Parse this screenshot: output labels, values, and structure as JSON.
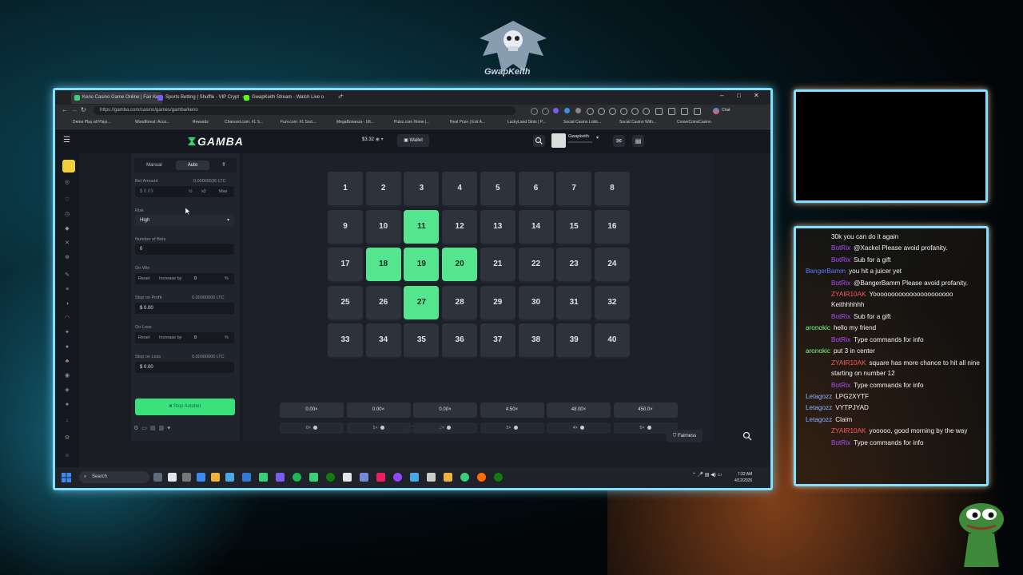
{
  "stream_overlay": {
    "logo_text": "GwapKeith"
  },
  "browser": {
    "tabs": [
      {
        "title": "Keno Casino Game Online | Fair Ke",
        "favicon_color": "#3ad07a",
        "active": true
      },
      {
        "title": "Sports Betting | Shuffle - VIP Crypt",
        "favicon_color": "#7b5cf0",
        "active": false
      },
      {
        "title": "GwapKeith Stream - Watch Live o",
        "favicon_color": "#53fc18",
        "active": false
      }
    ],
    "new_tab": "+",
    "url": "https://gamba.com/casino/games/gamba/keno",
    "bookmarks": [
      "Demo Play all Playi...",
      "Woodforest: Acco...",
      "Rewards",
      "Chanced.com: #1 S...",
      "Funr.com: #1 Soci...",
      "MegaBonanza - Ult...",
      "Pulsz.com Home |...",
      "Real Prize | Exit A...",
      "LuckyLand Slots | P...",
      "Social Casino Lobb...",
      "Social Casino With...",
      "CrownCoinsCasino"
    ],
    "profile_label": "Chat"
  },
  "site": {
    "brand": "GAMBA",
    "balance": "$3.32",
    "wallet_label": "Wallet",
    "username": "Gwapkeith"
  },
  "panel": {
    "tabs": [
      "Manual",
      "Auto"
    ],
    "active_tab": "Auto",
    "bet_amount_label": "Bet Amount",
    "bet_amount_ltc": "0.00065536 LTC",
    "bet_amount_value": "0.03",
    "half_label": "½",
    "double_label": "x2",
    "max_label": "Max",
    "risk_label": "Risk",
    "risk_value": "High",
    "num_bets_label": "Number of Bets",
    "num_bets_value": "0",
    "on_win_label": "On Win",
    "on_win_reset": "Reset",
    "on_win_increase": "Increase by",
    "on_win_value": "0",
    "on_win_unit": "%",
    "stop_profit_label": "Stop on Profit",
    "stop_profit_ltc": "0.00000000 LTC",
    "stop_profit_value": "0.00",
    "on_loss_label": "On Loss",
    "on_loss_reset": "Reset",
    "on_loss_increase": "Increase by",
    "on_loss_value": "0",
    "on_loss_unit": "%",
    "stop_loss_label": "Stop on Loss",
    "stop_loss_ltc": "0.00000000 LTC",
    "stop_loss_value": "0.00",
    "cta_label": "Stop Autobet"
  },
  "keno": {
    "numbers": [
      1,
      2,
      3,
      4,
      5,
      6,
      7,
      8,
      9,
      10,
      11,
      12,
      13,
      14,
      15,
      16,
      17,
      18,
      19,
      20,
      21,
      22,
      23,
      24,
      25,
      26,
      27,
      28,
      29,
      30,
      31,
      32,
      33,
      34,
      35,
      36,
      37,
      38,
      39,
      40
    ],
    "highlighted": [
      11,
      18,
      19,
      20,
      27
    ],
    "highlight_color": "#55e58f",
    "multipliers": [
      "0.00×",
      "0.00×",
      "0.00×",
      "4.50×",
      "48.00×",
      "450.0×"
    ],
    "hit_labels": [
      "0×",
      "1×",
      "2×",
      "3×",
      "4×",
      "5×"
    ]
  },
  "footer": {
    "fairness_label": "Fairness",
    "watermark": "GAMBA"
  },
  "taskbar": {
    "search_label": "Search",
    "time": "7:32 AM",
    "date": "4/12/2026"
  },
  "chat": {
    "messages": [
      {
        "user": "",
        "user_color": "#ffffff",
        "text": "30k you can do it again"
      },
      {
        "user": "BotRix",
        "user_color": "#b04cff",
        "text": "@Xackel Please avoid profanity."
      },
      {
        "user": "BotRix",
        "user_color": "#b04cff",
        "text": "Sub for a gift"
      },
      {
        "user": "BangerBamm",
        "user_color": "#5c7cff",
        "text": "you hit a juicer yet"
      },
      {
        "user": "BotRix",
        "user_color": "#b04cff",
        "text": "@BangerBamm Please avoid profanity."
      },
      {
        "user": "ZYAIR10AK",
        "user_color": "#ff5a5a",
        "text": "Yoooooooooooooooooooooo Keithhhhhh"
      },
      {
        "user": "BotRix",
        "user_color": "#b04cff",
        "text": "Sub for a gift"
      },
      {
        "user": "aronokic",
        "user_color": "#7cff7c",
        "text": "hello my friend"
      },
      {
        "user": "BotRix",
        "user_color": "#b04cff",
        "text": "Type commands for info"
      },
      {
        "user": "aronokic",
        "user_color": "#7cff7c",
        "text": "put 3 in center"
      },
      {
        "user": "ZYAIR10AK",
        "user_color": "#ff5a5a",
        "text": "square has more chance to hit all nine starting on number 12"
      },
      {
        "user": "BotRix",
        "user_color": "#b04cff",
        "text": "Type commands for info"
      },
      {
        "user": "Letagozz",
        "user_color": "#8ab4ff",
        "text": "LPG2XYTF"
      },
      {
        "user": "Letagozz",
        "user_color": "#8ab4ff",
        "text": "VYTPJYAD"
      },
      {
        "user": "Letagozz",
        "user_color": "#8ab4ff",
        "text": "Claim"
      },
      {
        "user": "ZYAIR10AK",
        "user_color": "#ff5a5a",
        "text": "yooooo, good morning by the way"
      },
      {
        "user": "BotRix",
        "user_color": "#b04cff",
        "text": "Type commands for info"
      }
    ]
  }
}
